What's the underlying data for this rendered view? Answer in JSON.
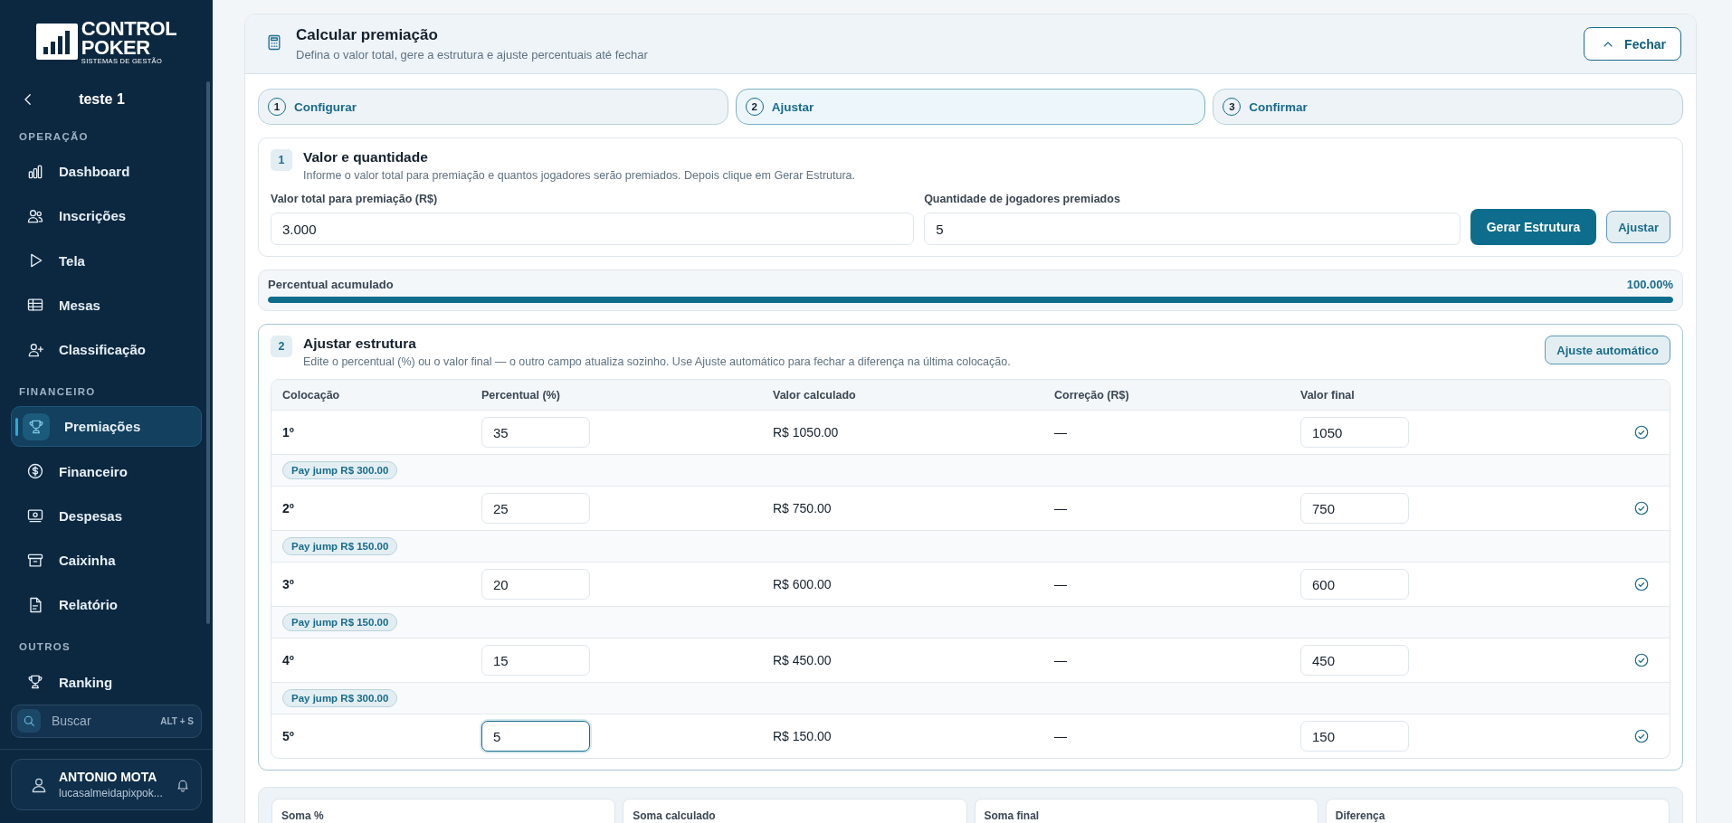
{
  "sidebar": {
    "logo": {
      "line1": "CONTROL",
      "line2": "POKER",
      "tagline": "SISTEMAS DE GESTÃO"
    },
    "back_title": "teste 1",
    "sections": [
      {
        "title": "OPERAÇÃO",
        "items": [
          {
            "label": "Dashboard",
            "kind": "bars",
            "selected": false
          },
          {
            "label": "Inscrições",
            "kind": "users",
            "selected": false
          },
          {
            "label": "Tela",
            "kind": "play",
            "selected": false
          },
          {
            "label": "Mesas",
            "kind": "table",
            "selected": false
          },
          {
            "label": "Classificação",
            "kind": "userplus",
            "selected": false
          }
        ]
      },
      {
        "title": "FINANCEIRO",
        "items": [
          {
            "label": "Premiações",
            "kind": "trophy",
            "selected": true
          },
          {
            "label": "Financeiro",
            "kind": "dollar",
            "selected": false
          },
          {
            "label": "Despesas",
            "kind": "banknote",
            "selected": false
          },
          {
            "label": "Caixinha",
            "kind": "archive",
            "selected": false
          },
          {
            "label": "Relatório",
            "kind": "document",
            "selected": false
          }
        ]
      },
      {
        "title": "OUTROS",
        "items": [
          {
            "label": "Ranking",
            "kind": "trophy",
            "selected": false
          }
        ]
      }
    ],
    "search": {
      "placeholder": "Buscar",
      "shortcut": "ALT + S"
    },
    "user": {
      "name": "ANTONIO MOTA",
      "email": "lucasalmeidapixpok..."
    }
  },
  "panel": {
    "title": "Calcular premiação",
    "subtitle": "Defina o valor total, gere a estrutura e ajuste percentuais até fechar",
    "close_button": "Fechar",
    "steps": [
      {
        "number": "1",
        "label": "Configurar",
        "selected": false
      },
      {
        "number": "2",
        "label": "Ajustar",
        "selected": true
      },
      {
        "number": "3",
        "label": "Confirmar",
        "selected": false
      }
    ],
    "section1": {
      "number": "1",
      "title": "Valor e quantidade",
      "description": "Informe o valor total para premiação e quantos jogadores serão premiados. Depois clique em Gerar Estrutura.",
      "fields": [
        {
          "label": "Valor total para premiação (R$)",
          "value": "3.000"
        },
        {
          "label": "Quantidade de jogadores premiados",
          "value": "5"
        }
      ],
      "buttons": [
        {
          "label": "Gerar Estrutura",
          "kind": "primary"
        },
        {
          "label": "Ajustar",
          "kind": "secondary"
        }
      ]
    },
    "progress": {
      "label": "Percentual acumulado",
      "reading": "100.00%",
      "level": 1
    },
    "section2": {
      "number": "2",
      "title": "Ajustar estrutura",
      "description": "Edite o percentual (%) ou o valor final — o outro campo atualiza sozinho. Use Ajuste automático para fechar a diferença na última colocação.",
      "auto_button": "Ajuste automático",
      "table": {
        "columns": [
          "Colocação",
          "Percentual (%)",
          "Valor calculado",
          "Correção (R$)",
          "Valor final"
        ],
        "rows": [
          {
            "place": "1º",
            "percent": "35",
            "calculated": "R$ 1050.00",
            "correction": "—",
            "final": "1050",
            "focused": false,
            "ok": true,
            "pay_jump": "Pay jump R$ 300.00"
          },
          {
            "place": "2º",
            "percent": "25",
            "calculated": "R$ 750.00",
            "correction": "—",
            "final": "750",
            "focused": false,
            "ok": true,
            "pay_jump": "Pay jump R$ 150.00"
          },
          {
            "place": "3º",
            "percent": "20",
            "calculated": "R$ 600.00",
            "correction": "—",
            "final": "600",
            "focused": false,
            "ok": true,
            "pay_jump": "Pay jump R$ 150.00"
          },
          {
            "place": "4º",
            "percent": "15",
            "calculated": "R$ 450.00",
            "correction": "—",
            "final": "450",
            "focused": false,
            "ok": true,
            "pay_jump": "Pay jump R$ 300.00"
          },
          {
            "place": "5º",
            "percent": "5",
            "calculated": "R$ 150.00",
            "correction": "—",
            "final": "150",
            "focused": true,
            "ok": true
          }
        ]
      }
    },
    "summary": [
      {
        "label": "Soma %"
      },
      {
        "label": "Soma calculado"
      },
      {
        "label": "Soma final"
      },
      {
        "label": "Diferença"
      }
    ]
  }
}
